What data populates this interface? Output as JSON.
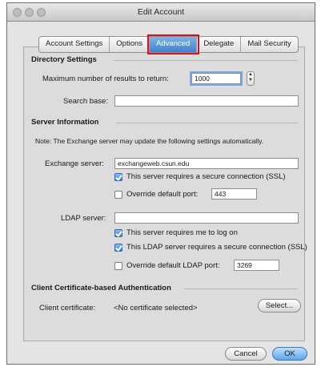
{
  "window": {
    "title": "Edit Account"
  },
  "tabs": [
    {
      "label": "Account Settings",
      "active": false
    },
    {
      "label": "Options",
      "active": false
    },
    {
      "label": "Advanced",
      "active": true
    },
    {
      "label": "Delegate",
      "active": false
    },
    {
      "label": "Mail Security",
      "active": false
    }
  ],
  "directory": {
    "heading": "Directory Settings",
    "max_results_label": "Maximum number of results to return:",
    "max_results_value": "1000",
    "search_base_label": "Search base:",
    "search_base_value": ""
  },
  "server": {
    "heading": "Server Information",
    "note": "Note: The Exchange server may update the following settings automatically.",
    "exchange_label": "Exchange server:",
    "exchange_value": "exchangeweb.csun.edu",
    "ssl_label": "This server requires a secure connection (SSL)",
    "ssl_checked": true,
    "override_port_label": "Override default port:",
    "override_port_checked": false,
    "port_value": "443",
    "ldap_label": "LDAP server:",
    "ldap_value": "",
    "logon_label": "This server requires me to log on",
    "logon_checked": true,
    "ldap_ssl_label": "This LDAP server requires a secure connection (SSL)",
    "ldap_ssl_checked": true,
    "override_ldap_label": "Override default LDAP port:",
    "override_ldap_checked": false,
    "ldap_port_value": "3269"
  },
  "cert": {
    "heading": "Client Certificate-based Authentication",
    "label": "Client certificate:",
    "value": "<No certificate selected>",
    "select_button": "Select..."
  },
  "footer": {
    "cancel": "Cancel",
    "ok": "OK"
  },
  "icons": {
    "stepper": "stepper-arrows-icon"
  }
}
